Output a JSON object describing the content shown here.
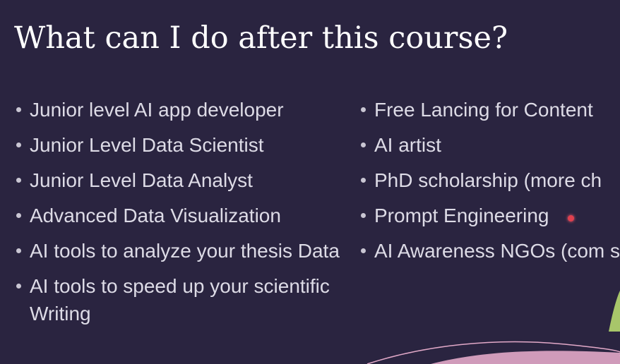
{
  "slide": {
    "title": "What can I do after this course?",
    "left_items": [
      "Junior level AI app developer",
      "Junior Level Data Scientist",
      "Junior Level Data Analyst",
      "Advanced Data Visualization",
      "AI tools to analyze your thesis Data",
      "AI tools to speed up your scientific Writing"
    ],
    "right_items": [
      "Free Lancing for Content",
      "AI artist",
      "PhD scholarship (more ch",
      "Prompt Engineering",
      "AI Awareness NGOs (com soon)"
    ]
  },
  "colors": {
    "background": "#2a2440",
    "title": "#ffffff",
    "text": "#dddbe6",
    "pointer": "#e0404e",
    "decor_pink": "#e2a9c8",
    "decor_green": "#a8c66a"
  },
  "icons": {
    "bullet": "bullet-dot-icon",
    "laser_pointer": "laser-pointer-icon"
  }
}
